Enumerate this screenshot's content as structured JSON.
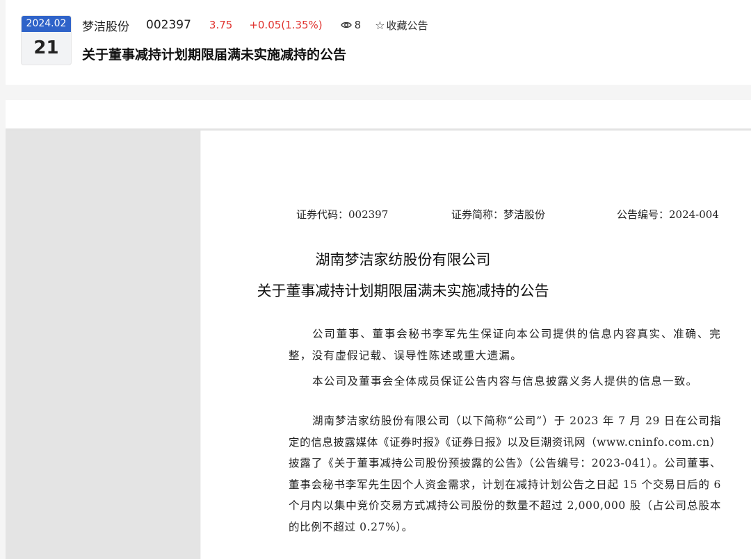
{
  "header": {
    "date": {
      "month": "2024.02",
      "day": "21"
    },
    "stock_name": "梦洁股份",
    "stock_code": "002397",
    "price": "3.75",
    "change": "+0.05(1.35%)",
    "views": "8",
    "collect_label": "收藏公告",
    "title": "关于董事减持计划期限届满未实施减持的公告",
    "accent_color": "#2f63c9",
    "up_color": "#e0312d"
  },
  "document": {
    "code_line": "证券代码：002397",
    "short_name_line": "证券简称：梦洁股份",
    "notice_no_line": "公告编号：2024-004",
    "company": "湖南梦洁家纺股份有限公司",
    "title": "关于董事减持计划期限届满未实施减持的公告",
    "statement_1": "公司董事、董事会秘书李军先生保证向本公司提供的信息内容真实、准确、完整，没有虚假记载、误导性陈述或重大遗漏。",
    "statement_2": "本公司及董事会全体成员保证公告内容与信息披露义务人提供的信息一致。",
    "body_1": "湖南梦洁家纺股份有限公司（以下简称“公司”）于 2023 年 7 月 29 日在公司指定的信息披露媒体《证券时报》《证券日报》以及巨潮资讯网（www.cninfo.com.cn）披露了《关于董事减持公司股份预披露的公告》（公告编号：2023-041）。公司董事、董事会秘书李军先生因个人资金需求，计划在减持计划公告之日起 15 个交易日后的 6 个月内以集中竞价交易方式减持公司股份的数量不超过 2,000,000 股（占公司总股本的比例不超过 0.27%）。"
  }
}
